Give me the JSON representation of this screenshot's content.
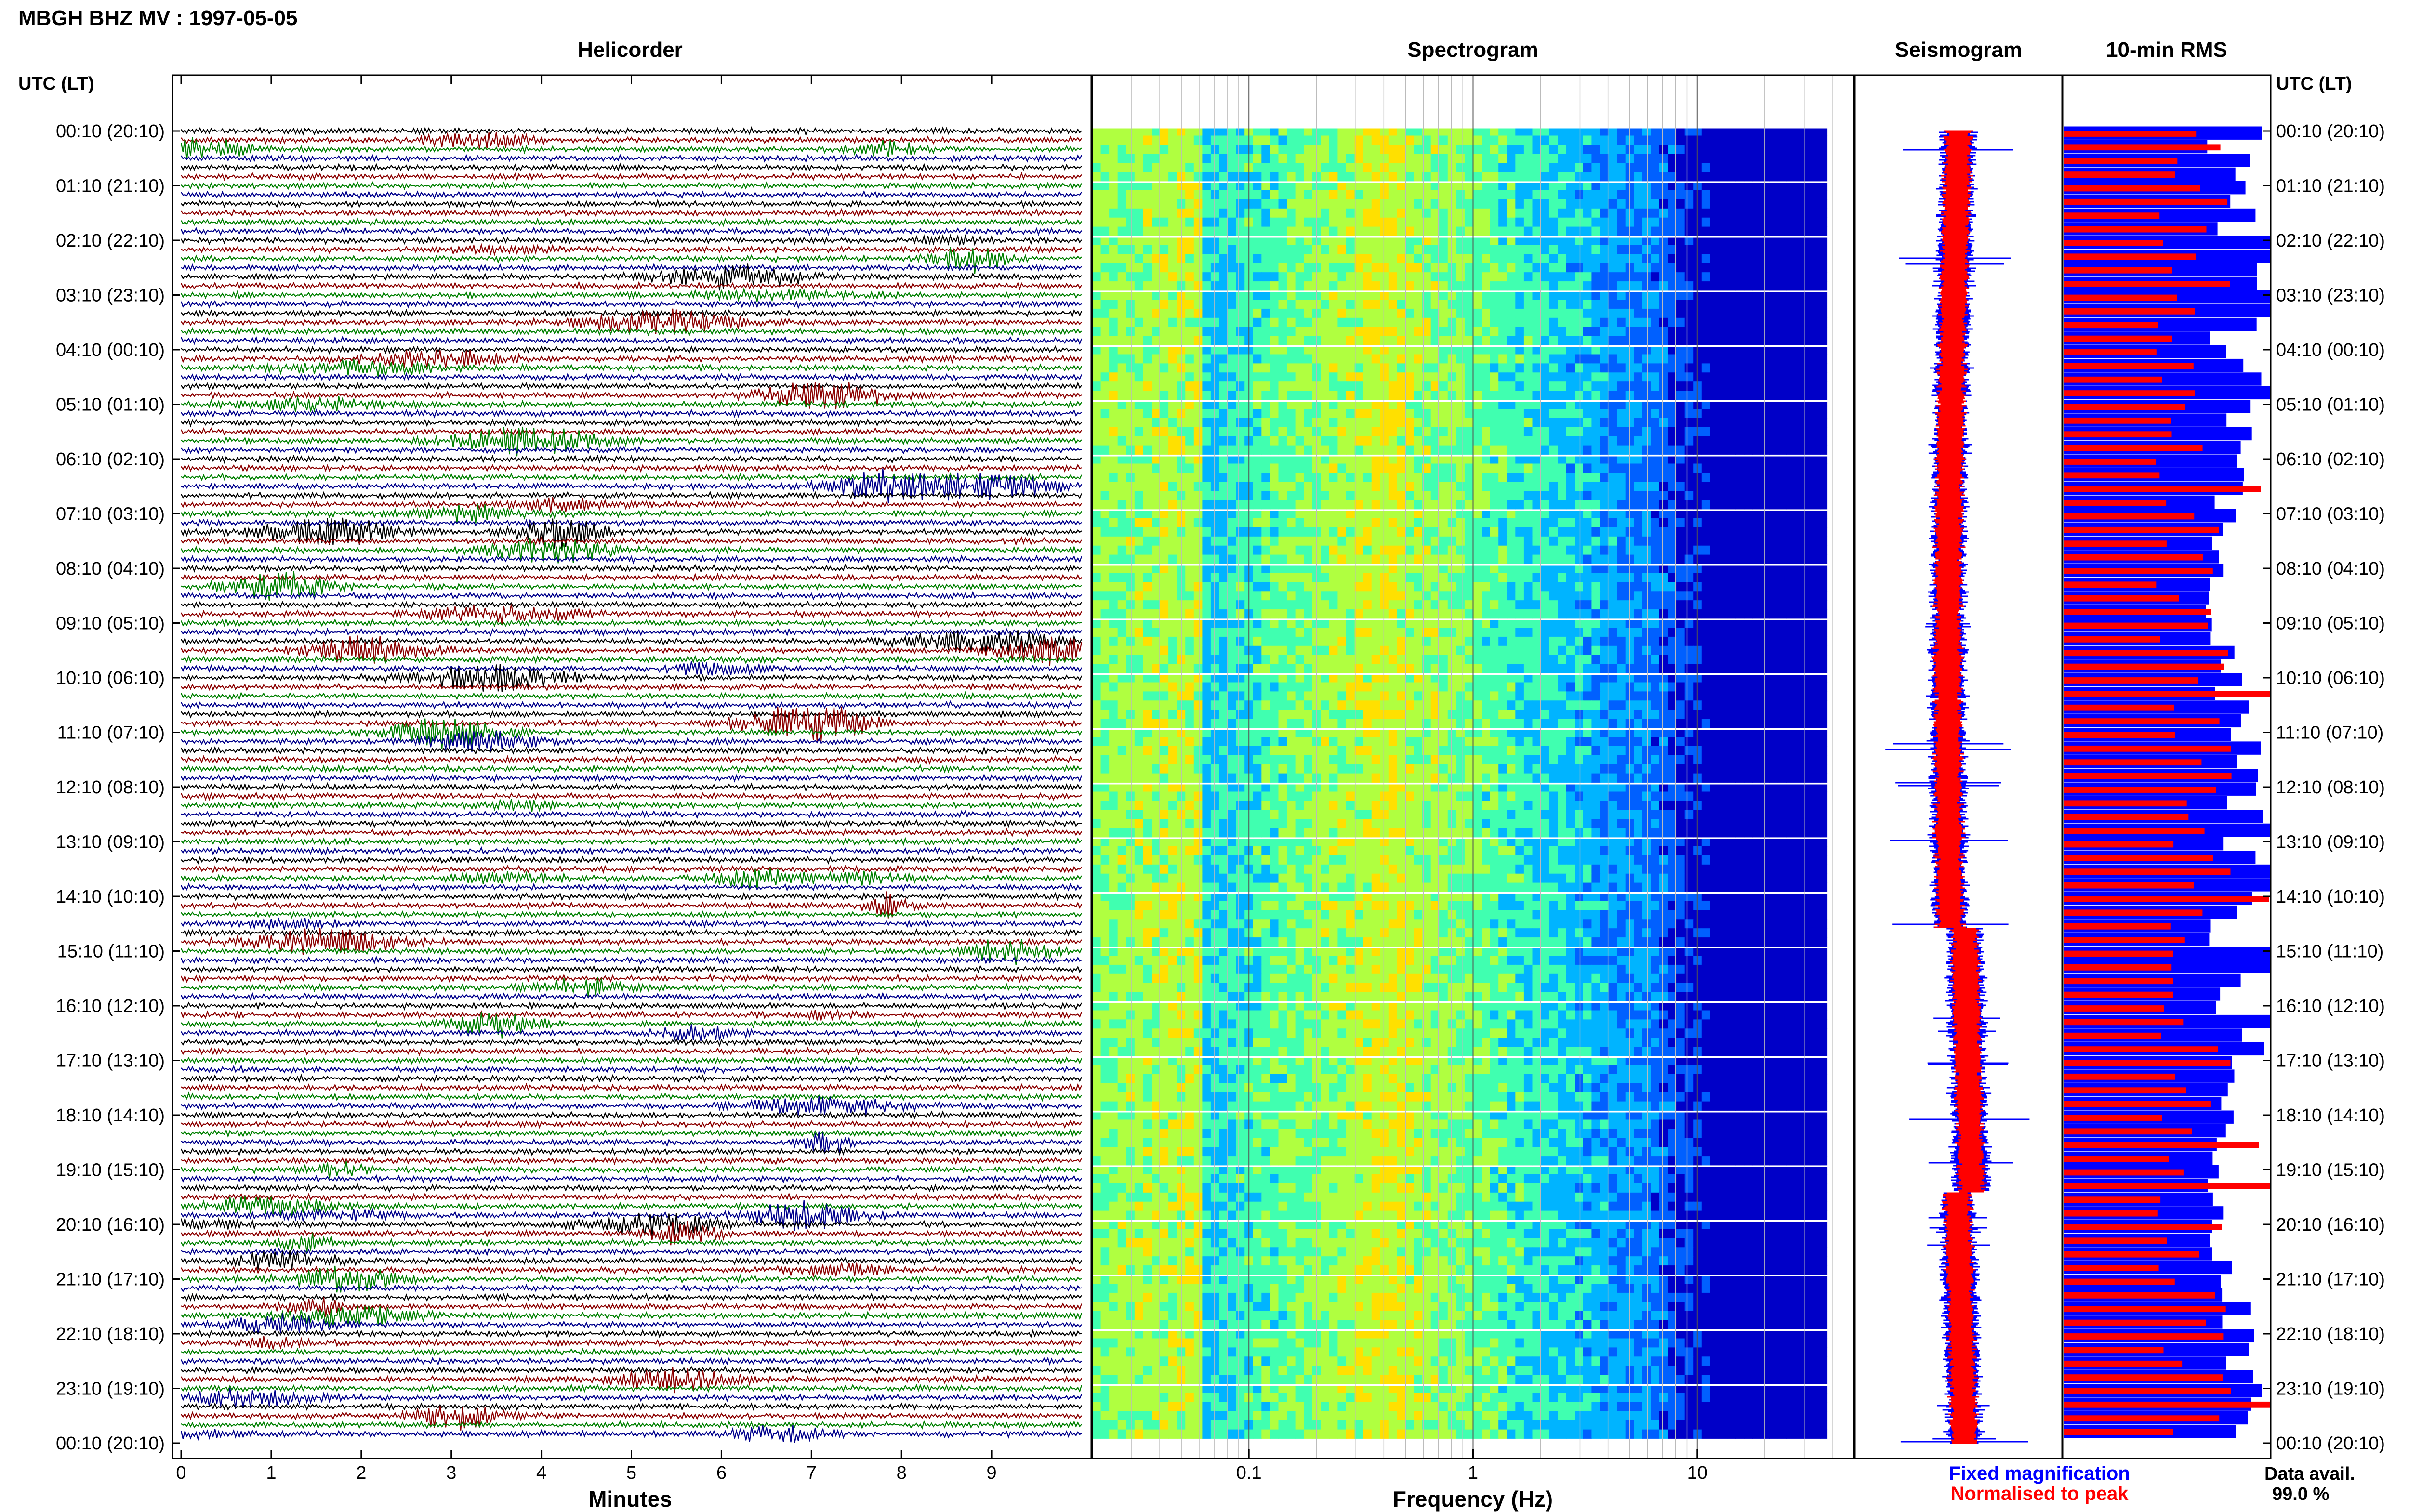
{
  "header": {
    "title": "MBGH BHZ MV : 1997-05-05",
    "utc_label_left": "UTC (LT)",
    "utc_label_right": "UTC (LT)"
  },
  "panels": {
    "helicorder": "Helicorder",
    "spectrogram": "Spectrogram",
    "seismogram": "Seismogram",
    "rms": "10-min RMS"
  },
  "legend": {
    "fixed": "Fixed magnification",
    "normalised": "Normalised to peak",
    "fixed_color": "#0000ff",
    "normalised_color": "#ff0000"
  },
  "data_avail": {
    "label": "Data avail.",
    "value": "99.0 %"
  },
  "chart_data": [
    {
      "type": "line",
      "panel": "helicorder",
      "xlabel": "Minutes",
      "x_ticks": [
        "0",
        "1",
        "2",
        "3",
        "4",
        "5",
        "6",
        "7",
        "8",
        "9"
      ],
      "xlim": [
        0,
        10
      ],
      "row_count": 144,
      "trace_colors": [
        "#000000",
        "#8b0000",
        "#008000",
        "#00008b"
      ],
      "y_tick_labels": [
        "00:10 (20:10)",
        "01:10 (21:10)",
        "02:10 (22:10)",
        "03:10 (23:10)",
        "04:10 (00:10)",
        "05:10 (01:10)",
        "06:10 (02:10)",
        "07:10 (03:10)",
        "08:10 (04:10)",
        "09:10 (05:10)",
        "10:10 (06:10)",
        "11:10 (07:10)",
        "12:10 (08:10)",
        "13:10 (09:10)",
        "14:10 (10:10)",
        "15:10 (11:10)",
        "16:10 (12:10)",
        "17:10 (13:10)",
        "18:10 (14:10)",
        "19:10 (15:10)",
        "20:10 (16:10)",
        "21:10 (17:10)",
        "22:10 (18:10)",
        "23:10 (19:10)",
        "00:10 (20:10)"
      ]
    },
    {
      "type": "heatmap",
      "panel": "spectrogram",
      "xlabel": "Frequency (Hz)",
      "x_scale": "log",
      "xlim": [
        0.02,
        50
      ],
      "x_ticks": [
        0.1,
        1,
        10
      ],
      "x_tick_labels": [
        "0.1",
        "1",
        "10"
      ],
      "peak_frequency_hz": 0.4,
      "colormap": [
        "#0000c8",
        "#0060ff",
        "#00b4ff",
        "#40ffb0",
        "#b0ff40",
        "#ffe000",
        "#ff6000"
      ]
    },
    {
      "type": "line",
      "panel": "seismogram",
      "series": [
        {
          "name": "Fixed magnification",
          "color": "#0000ff"
        },
        {
          "name": "Normalised to peak",
          "color": "#ff0000"
        }
      ]
    },
    {
      "type": "bar",
      "panel": "rms",
      "orientation": "horizontal",
      "series": [
        {
          "name": "Fixed magnification",
          "color": "#0000ff"
        },
        {
          "name": "Normalised to peak",
          "color": "#ff0000"
        }
      ]
    }
  ]
}
